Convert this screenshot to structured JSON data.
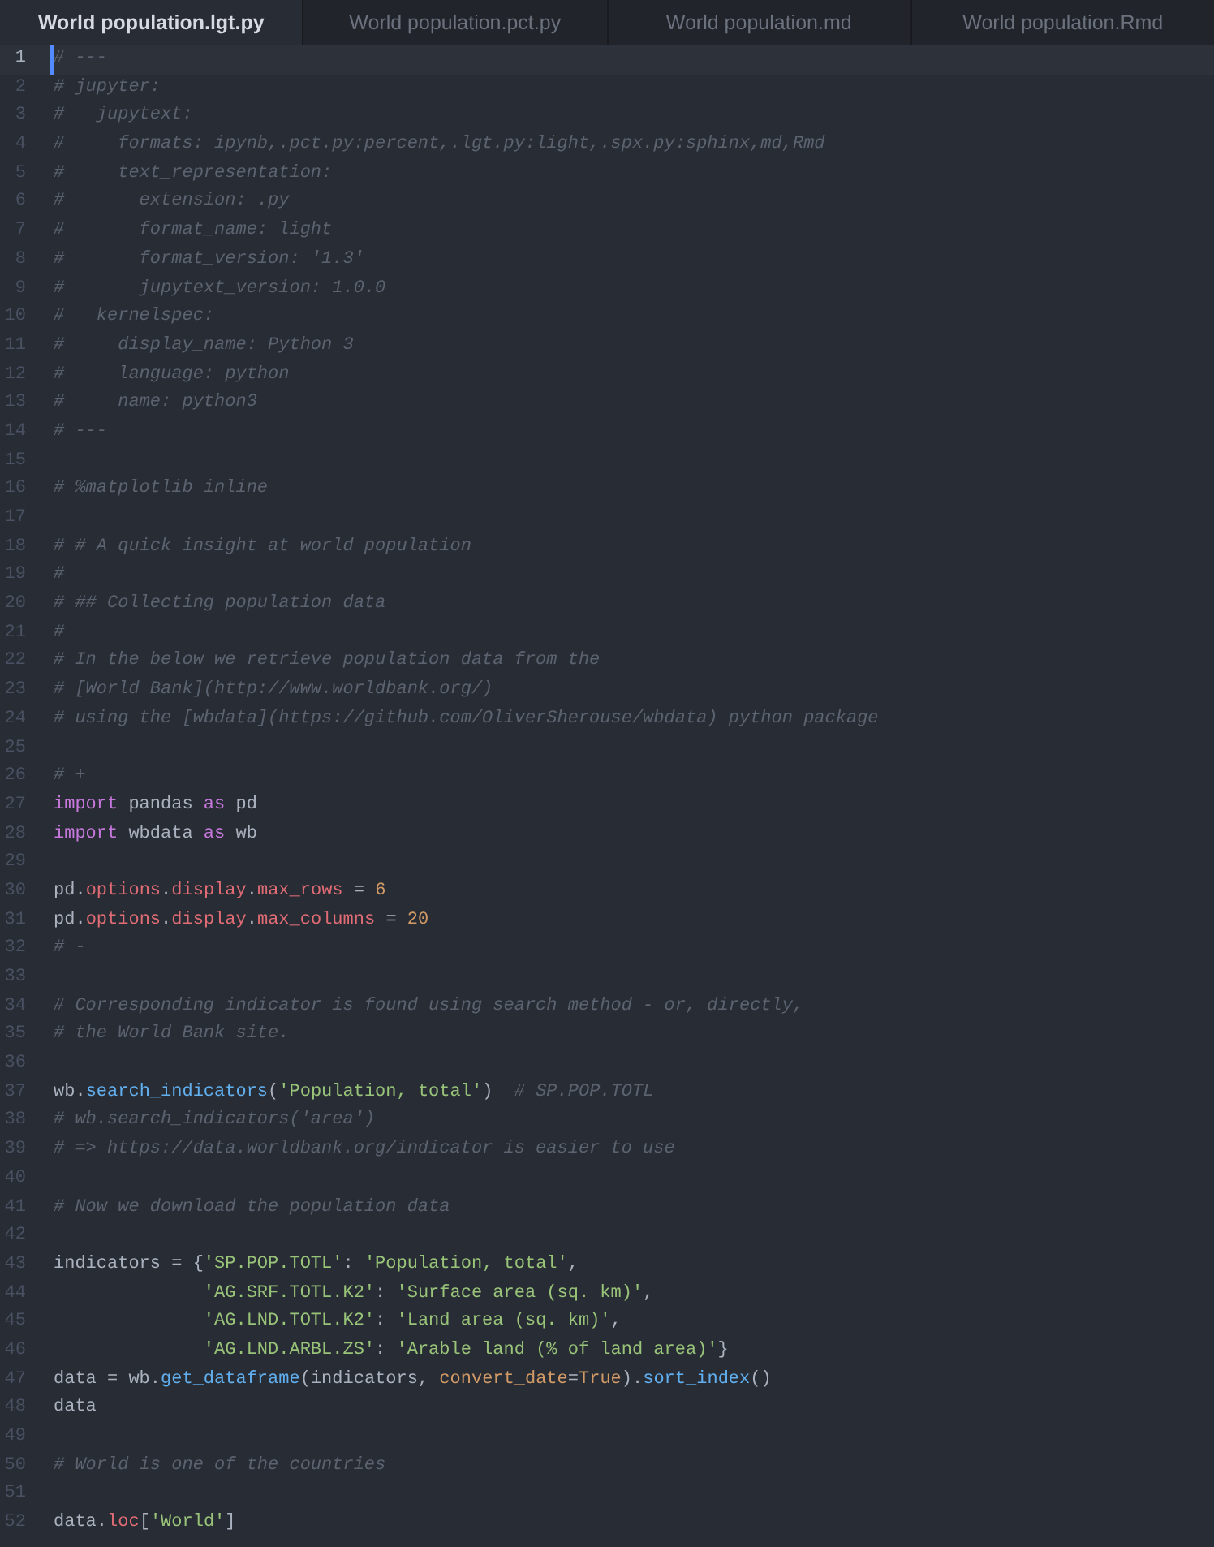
{
  "tabs": [
    {
      "label": "World population.lgt.py",
      "selected": true
    },
    {
      "label": "World population.pct.py",
      "selected": false
    },
    {
      "label": "World population.md",
      "selected": false
    },
    {
      "label": "World population.Rmd",
      "selected": false
    }
  ],
  "editor": {
    "lines": [
      {
        "number": "1",
        "current": true,
        "tokens": [
          {
            "kind": "comment",
            "text": "# ---"
          }
        ]
      },
      {
        "number": "2",
        "current": false,
        "tokens": [
          {
            "kind": "comment",
            "text": "# jupyter:"
          }
        ]
      },
      {
        "number": "3",
        "current": false,
        "tokens": [
          {
            "kind": "comment",
            "text": "#   jupytext:"
          }
        ]
      },
      {
        "number": "4",
        "current": false,
        "tokens": [
          {
            "kind": "comment",
            "text": "#     formats: ipynb,.pct.py:percent,.lgt.py:light,.spx.py:sphinx,md,Rmd"
          }
        ]
      },
      {
        "number": "5",
        "current": false,
        "tokens": [
          {
            "kind": "comment",
            "text": "#     text_representation:"
          }
        ]
      },
      {
        "number": "6",
        "current": false,
        "tokens": [
          {
            "kind": "comment",
            "text": "#       extension: .py"
          }
        ]
      },
      {
        "number": "7",
        "current": false,
        "tokens": [
          {
            "kind": "comment",
            "text": "#       format_name: light"
          }
        ]
      },
      {
        "number": "8",
        "current": false,
        "tokens": [
          {
            "kind": "comment",
            "text": "#       format_version: '1.3'"
          }
        ]
      },
      {
        "number": "9",
        "current": false,
        "tokens": [
          {
            "kind": "comment",
            "text": "#       jupytext_version: 1.0.0"
          }
        ]
      },
      {
        "number": "10",
        "current": false,
        "tokens": [
          {
            "kind": "comment",
            "text": "#   kernelspec:"
          }
        ]
      },
      {
        "number": "11",
        "current": false,
        "tokens": [
          {
            "kind": "comment",
            "text": "#     display_name: Python 3"
          }
        ]
      },
      {
        "number": "12",
        "current": false,
        "tokens": [
          {
            "kind": "comment",
            "text": "#     language: python"
          }
        ]
      },
      {
        "number": "13",
        "current": false,
        "tokens": [
          {
            "kind": "comment",
            "text": "#     name: python3"
          }
        ]
      },
      {
        "number": "14",
        "current": false,
        "tokens": [
          {
            "kind": "comment",
            "text": "# ---"
          }
        ]
      },
      {
        "number": "15",
        "current": false
      },
      {
        "number": "16",
        "current": false,
        "tokens": [
          {
            "kind": "comment",
            "text": "# %matplotlib inline"
          }
        ]
      },
      {
        "number": "17",
        "current": false
      },
      {
        "number": "18",
        "current": false,
        "tokens": [
          {
            "kind": "comment",
            "text": "# # A quick insight at world population"
          }
        ]
      },
      {
        "number": "19",
        "current": false,
        "tokens": [
          {
            "kind": "comment",
            "text": "#"
          }
        ]
      },
      {
        "number": "20",
        "current": false,
        "tokens": [
          {
            "kind": "comment",
            "text": "# ## Collecting population data"
          }
        ]
      },
      {
        "number": "21",
        "current": false,
        "tokens": [
          {
            "kind": "comment",
            "text": "#"
          }
        ]
      },
      {
        "number": "22",
        "current": false,
        "tokens": [
          {
            "kind": "comment",
            "text": "# In the below we retrieve population data from the"
          }
        ]
      },
      {
        "number": "23",
        "current": false,
        "tokens": [
          {
            "kind": "comment",
            "text": "# [World Bank](http://www.worldbank.org/)"
          }
        ]
      },
      {
        "number": "24",
        "current": false,
        "tokens": [
          {
            "kind": "comment",
            "text": "# using the [wbdata](https://github.com/OliverSherouse/wbdata) python package"
          }
        ]
      },
      {
        "number": "25",
        "current": false
      },
      {
        "number": "26",
        "current": false,
        "tokens": [
          {
            "kind": "comment",
            "text": "# +"
          }
        ]
      },
      {
        "number": "27",
        "current": false,
        "tokens": [
          {
            "kind": "keyword",
            "text": "import"
          },
          {
            "kind": "text",
            "text": " pandas "
          },
          {
            "kind": "keyword",
            "text": "as"
          },
          {
            "kind": "text",
            "text": " pd"
          }
        ]
      },
      {
        "number": "28",
        "current": false,
        "tokens": [
          {
            "kind": "keyword",
            "text": "import"
          },
          {
            "kind": "text",
            "text": " wbdata "
          },
          {
            "kind": "keyword",
            "text": "as"
          },
          {
            "kind": "text",
            "text": " wb"
          }
        ]
      },
      {
        "number": "29",
        "current": false
      },
      {
        "number": "30",
        "current": false,
        "tokens": [
          {
            "kind": "text",
            "text": "pd."
          },
          {
            "kind": "property",
            "text": "options"
          },
          {
            "kind": "text",
            "text": "."
          },
          {
            "kind": "property",
            "text": "display"
          },
          {
            "kind": "text",
            "text": "."
          },
          {
            "kind": "property",
            "text": "max_rows"
          },
          {
            "kind": "text",
            "text": " = "
          },
          {
            "kind": "number",
            "text": "6"
          }
        ]
      },
      {
        "number": "31",
        "current": false,
        "tokens": [
          {
            "kind": "text",
            "text": "pd."
          },
          {
            "kind": "property",
            "text": "options"
          },
          {
            "kind": "text",
            "text": "."
          },
          {
            "kind": "property",
            "text": "display"
          },
          {
            "kind": "text",
            "text": "."
          },
          {
            "kind": "property",
            "text": "max_columns"
          },
          {
            "kind": "text",
            "text": " = "
          },
          {
            "kind": "number",
            "text": "20"
          }
        ]
      },
      {
        "number": "32",
        "current": false,
        "tokens": [
          {
            "kind": "comment",
            "text": "# -"
          }
        ]
      },
      {
        "number": "33",
        "current": false
      },
      {
        "number": "34",
        "current": false,
        "tokens": [
          {
            "kind": "comment",
            "text": "# Corresponding indicator is found using search method - or, directly,"
          }
        ]
      },
      {
        "number": "35",
        "current": false,
        "tokens": [
          {
            "kind": "comment",
            "text": "# the World Bank site."
          }
        ]
      },
      {
        "number": "36",
        "current": false
      },
      {
        "number": "37",
        "current": false,
        "tokens": [
          {
            "kind": "text",
            "text": "wb."
          },
          {
            "kind": "function",
            "text": "search_indicators"
          },
          {
            "kind": "text",
            "text": "("
          },
          {
            "kind": "string",
            "text": "'Population, total'"
          },
          {
            "kind": "text",
            "text": ")"
          },
          {
            "kind": "comment",
            "text": "  # SP.POP.TOTL"
          }
        ]
      },
      {
        "number": "38",
        "current": false,
        "tokens": [
          {
            "kind": "comment",
            "text": "# wb.search_indicators('area')"
          }
        ]
      },
      {
        "number": "39",
        "current": false,
        "tokens": [
          {
            "kind": "comment",
            "text": "# => https://data.worldbank.org/indicator is easier to use"
          }
        ]
      },
      {
        "number": "40",
        "current": false
      },
      {
        "number": "41",
        "current": false,
        "tokens": [
          {
            "kind": "comment",
            "text": "# Now we download the population data"
          }
        ]
      },
      {
        "number": "42",
        "current": false
      },
      {
        "number": "43",
        "current": false,
        "tokens": [
          {
            "kind": "text",
            "text": "indicators = {"
          },
          {
            "kind": "string",
            "text": "'SP.POP.TOTL'"
          },
          {
            "kind": "text",
            "text": ": "
          },
          {
            "kind": "string",
            "text": "'Population, total'"
          },
          {
            "kind": "text",
            "text": ","
          }
        ]
      },
      {
        "number": "44",
        "current": false,
        "tokens": [
          {
            "kind": "string",
            "text": "              'AG.SRF.TOTL.K2'"
          },
          {
            "kind": "text",
            "text": ": "
          },
          {
            "kind": "string",
            "text": "'Surface area (sq. km)'"
          },
          {
            "kind": "text",
            "text": ","
          }
        ]
      },
      {
        "number": "45",
        "current": false,
        "tokens": [
          {
            "kind": "string",
            "text": "              'AG.LND.TOTL.K2'"
          },
          {
            "kind": "text",
            "text": ": "
          },
          {
            "kind": "string",
            "text": "'Land area (sq. km)'"
          },
          {
            "kind": "text",
            "text": ","
          }
        ]
      },
      {
        "number": "46",
        "current": false,
        "tokens": [
          {
            "kind": "string",
            "text": "              'AG.LND.ARBL.ZS'"
          },
          {
            "kind": "text",
            "text": ": "
          },
          {
            "kind": "string",
            "text": "'Arable land (% of land area)'"
          },
          {
            "kind": "text",
            "text": "}"
          }
        ]
      },
      {
        "number": "47",
        "current": false,
        "tokens": [
          {
            "kind": "text",
            "text": "data = wb."
          },
          {
            "kind": "function",
            "text": "get_dataframe"
          },
          {
            "kind": "text",
            "text": "(indicators, "
          },
          {
            "kind": "parameter",
            "text": "convert_date"
          },
          {
            "kind": "text",
            "text": "="
          },
          {
            "kind": "constant",
            "text": "True"
          },
          {
            "kind": "text",
            "text": ")."
          },
          {
            "kind": "function",
            "text": "sort_index"
          },
          {
            "kind": "text",
            "text": "()"
          }
        ]
      },
      {
        "number": "48",
        "current": false,
        "tokens": [
          {
            "kind": "text",
            "text": "data"
          }
        ]
      },
      {
        "number": "49",
        "current": false
      },
      {
        "number": "50",
        "current": false,
        "tokens": [
          {
            "kind": "comment",
            "text": "# World is one of the countries"
          }
        ]
      },
      {
        "number": "51",
        "current": false
      },
      {
        "number": "52",
        "current": false,
        "tokens": [
          {
            "kind": "text",
            "text": "data."
          },
          {
            "kind": "property",
            "text": "loc"
          },
          {
            "kind": "text",
            "text": "["
          },
          {
            "kind": "string",
            "text": "'World'"
          },
          {
            "kind": "text",
            "text": "]"
          }
        ]
      }
    ]
  }
}
